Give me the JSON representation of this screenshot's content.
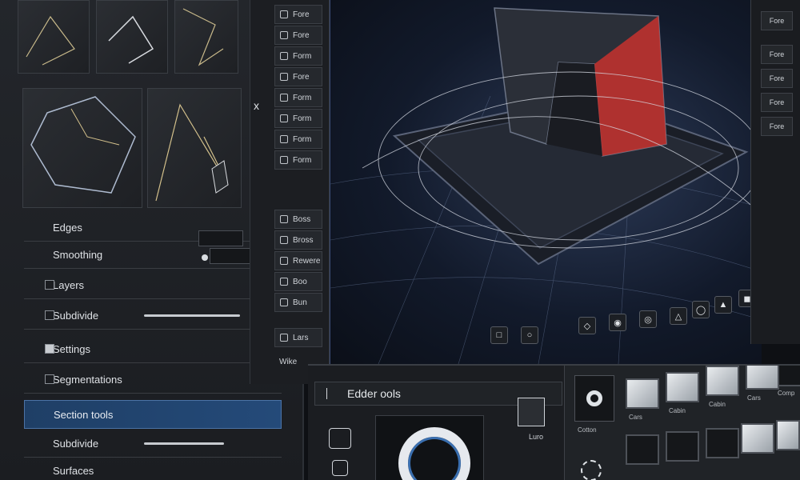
{
  "left_panel": {
    "rows": [
      {
        "label": "Edges"
      },
      {
        "label": "Smoothing"
      },
      {
        "label": "Layers"
      },
      {
        "label": "Subdivide"
      },
      {
        "label": "Settings"
      },
      {
        "label": "Segmentations"
      },
      {
        "label": "Section tools"
      },
      {
        "label": "Subdivide"
      },
      {
        "label": "Surfaces"
      }
    ]
  },
  "tools": {
    "items": [
      "Fore",
      "Fore",
      "Form",
      "Fore",
      "Form",
      "Form",
      "Form",
      "Form",
      "Boss",
      "Bross",
      "Rewere",
      "Boo",
      "Bun",
      "Lars",
      "Wike"
    ],
    "close_glyph": "x"
  },
  "bottom_panel": {
    "title": "Edder ools",
    "label_a": "Luro",
    "swatch_labels": [
      "Cotton",
      "Cars",
      "Cabin",
      "Cabin",
      "Cars",
      "Comp"
    ]
  },
  "right_panel": {
    "items": [
      "Fore",
      "Fore",
      "Fore",
      "Fore",
      "Fore"
    ]
  },
  "colors": {
    "accent": "#3a6fb0",
    "highlight_red": "#c7312e"
  }
}
